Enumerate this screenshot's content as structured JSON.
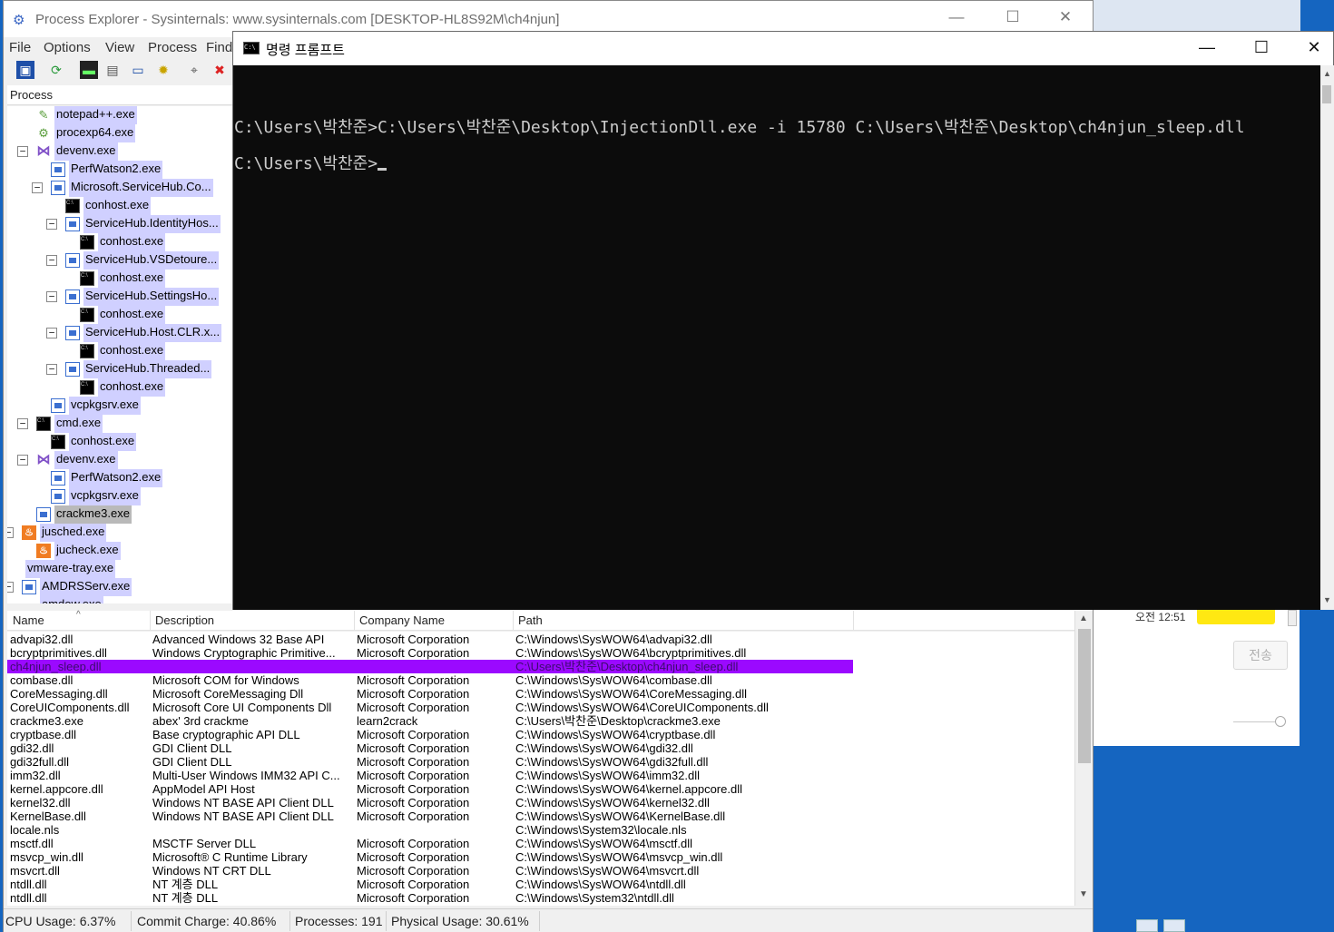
{
  "background_window": {
    "time": "오전 12:51",
    "send_button": "전송"
  },
  "procexp": {
    "title": "Process Explorer - Sysinternals: www.sysinternals.com [DESKTOP-HL8S92M\\ch4njun]",
    "menu": [
      "File",
      "Options",
      "View",
      "Process",
      "Find"
    ],
    "tree_header": "Process",
    "processes": [
      {
        "name": "notepad++.exe",
        "icon": "notepad-icon"
      },
      {
        "name": "procexp64.exe",
        "icon": "procexp-icon"
      },
      {
        "name": "devenv.exe",
        "icon": "visual-studio-icon"
      },
      {
        "name": "PerfWatson2.exe",
        "icon": "window-icon"
      },
      {
        "name": "Microsoft.ServiceHub.Co...",
        "icon": "window-icon"
      },
      {
        "name": "conhost.exe",
        "icon": "console-icon"
      },
      {
        "name": "ServiceHub.IdentityHos...",
        "icon": "window-icon"
      },
      {
        "name": "conhost.exe",
        "icon": "console-icon"
      },
      {
        "name": "ServiceHub.VSDetoure...",
        "icon": "window-icon"
      },
      {
        "name": "conhost.exe",
        "icon": "console-icon"
      },
      {
        "name": "ServiceHub.SettingsHo...",
        "icon": "window-icon"
      },
      {
        "name": "conhost.exe",
        "icon": "console-icon"
      },
      {
        "name": "ServiceHub.Host.CLR.x...",
        "icon": "window-icon"
      },
      {
        "name": "conhost.exe",
        "icon": "console-icon"
      },
      {
        "name": "ServiceHub.Threaded...",
        "icon": "window-icon"
      },
      {
        "name": "conhost.exe",
        "icon": "console-icon"
      },
      {
        "name": "vcpkgsrv.exe",
        "icon": "window-icon"
      },
      {
        "name": "cmd.exe",
        "icon": "console-icon"
      },
      {
        "name": "conhost.exe",
        "icon": "console-icon"
      },
      {
        "name": "devenv.exe",
        "icon": "visual-studio-icon"
      },
      {
        "name": "PerfWatson2.exe",
        "icon": "window-icon"
      },
      {
        "name": "vcpkgsrv.exe",
        "icon": "window-icon"
      },
      {
        "name": "crackme3.exe",
        "icon": "window-icon"
      },
      {
        "name": "jusched.exe",
        "icon": "java-icon"
      },
      {
        "name": "jucheck.exe",
        "icon": "java-icon"
      },
      {
        "name": "vmware-tray.exe",
        "icon": ""
      },
      {
        "name": "AMDRSServ.exe",
        "icon": "window-icon"
      },
      {
        "name": "amdow.exe",
        "icon": ""
      }
    ],
    "dll_columns": [
      "Name",
      "Description",
      "Company Name",
      "Path"
    ],
    "dlls": [
      {
        "name": "advapi32.dll",
        "desc": "Advanced Windows 32 Base API",
        "company": "Microsoft Corporation",
        "path": "C:\\Windows\\SysWOW64\\advapi32.dll"
      },
      {
        "name": "bcryptprimitives.dll",
        "desc": "Windows Cryptographic Primitive...",
        "company": "Microsoft Corporation",
        "path": "C:\\Windows\\SysWOW64\\bcryptprimitives.dll"
      },
      {
        "name": "ch4njun_sleep.dll",
        "desc": "",
        "company": "",
        "path": "C:\\Users\\박찬준\\Desktop\\ch4njun_sleep.dll"
      },
      {
        "name": "combase.dll",
        "desc": "Microsoft COM for Windows",
        "company": "Microsoft Corporation",
        "path": "C:\\Windows\\SysWOW64\\combase.dll"
      },
      {
        "name": "CoreMessaging.dll",
        "desc": "Microsoft CoreMessaging Dll",
        "company": "Microsoft Corporation",
        "path": "C:\\Windows\\SysWOW64\\CoreMessaging.dll"
      },
      {
        "name": "CoreUIComponents.dll",
        "desc": "Microsoft Core UI Components Dll",
        "company": "Microsoft Corporation",
        "path": "C:\\Windows\\SysWOW64\\CoreUIComponents.dll"
      },
      {
        "name": "crackme3.exe",
        "desc": "abex' 3rd crackme",
        "company": "learn2crack",
        "path": "C:\\Users\\박찬준\\Desktop\\crackme3.exe"
      },
      {
        "name": "cryptbase.dll",
        "desc": "Base cryptographic API DLL",
        "company": "Microsoft Corporation",
        "path": "C:\\Windows\\SysWOW64\\cryptbase.dll"
      },
      {
        "name": "gdi32.dll",
        "desc": "GDI Client DLL",
        "company": "Microsoft Corporation",
        "path": "C:\\Windows\\SysWOW64\\gdi32.dll"
      },
      {
        "name": "gdi32full.dll",
        "desc": "GDI Client DLL",
        "company": "Microsoft Corporation",
        "path": "C:\\Windows\\SysWOW64\\gdi32full.dll"
      },
      {
        "name": "imm32.dll",
        "desc": "Multi-User Windows IMM32 API C...",
        "company": "Microsoft Corporation",
        "path": "C:\\Windows\\SysWOW64\\imm32.dll"
      },
      {
        "name": "kernel.appcore.dll",
        "desc": "AppModel API Host",
        "company": "Microsoft Corporation",
        "path": "C:\\Windows\\SysWOW64\\kernel.appcore.dll"
      },
      {
        "name": "kernel32.dll",
        "desc": "Windows NT BASE API Client DLL",
        "company": "Microsoft Corporation",
        "path": "C:\\Windows\\SysWOW64\\kernel32.dll"
      },
      {
        "name": "KernelBase.dll",
        "desc": "Windows NT BASE API Client DLL",
        "company": "Microsoft Corporation",
        "path": "C:\\Windows\\SysWOW64\\KernelBase.dll"
      },
      {
        "name": "locale.nls",
        "desc": "",
        "company": "",
        "path": "C:\\Windows\\System32\\locale.nls"
      },
      {
        "name": "msctf.dll",
        "desc": "MSCTF Server DLL",
        "company": "Microsoft Corporation",
        "path": "C:\\Windows\\SysWOW64\\msctf.dll"
      },
      {
        "name": "msvcp_win.dll",
        "desc": "Microsoft® C Runtime Library",
        "company": "Microsoft Corporation",
        "path": "C:\\Windows\\SysWOW64\\msvcp_win.dll"
      },
      {
        "name": "msvcrt.dll",
        "desc": "Windows NT CRT DLL",
        "company": "Microsoft Corporation",
        "path": "C:\\Windows\\SysWOW64\\msvcrt.dll"
      },
      {
        "name": "ntdll.dll",
        "desc": "NT 계층 DLL",
        "company": "Microsoft Corporation",
        "path": "C:\\Windows\\SysWOW64\\ntdll.dll"
      },
      {
        "name": "ntdll.dll",
        "desc": "NT 계층 DLL",
        "company": "Microsoft Corporation",
        "path": "C:\\Windows\\System32\\ntdll.dll"
      }
    ],
    "status": {
      "cpu": "CPU Usage: 6.37%",
      "commit": "Commit Charge: 40.86%",
      "processes": "Processes: 191",
      "physical": "Physical Usage: 30.61%"
    },
    "highlight_color": "#9b09ff",
    "tree_highlight_color": "#d0d0ff"
  },
  "cmd": {
    "title": "명령 프롬프트",
    "lines": [
      "C:\\Users\\박찬준>C:\\Users\\박찬준\\Desktop\\InjectionDll.exe -i 15780 C:\\Users\\박찬준\\Desktop\\ch4njun_sleep.dll",
      "C:\\Users\\박찬준>"
    ]
  }
}
